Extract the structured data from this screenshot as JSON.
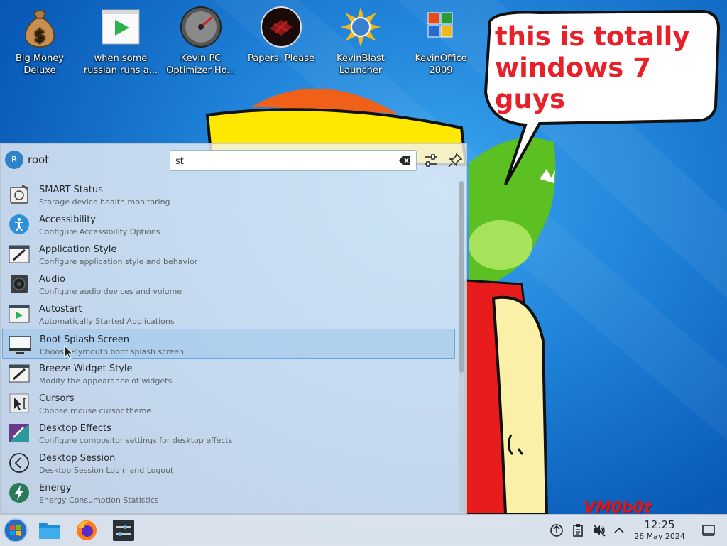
{
  "desktop": {
    "icons": [
      {
        "label": "Big Money\nDeluxe"
      },
      {
        "label": "when some\nrussian runs a..."
      },
      {
        "label": "Kevin PC\nOptimizer Ho..."
      },
      {
        "label": "Papers, Please"
      },
      {
        "label": "KevinBlast\nLauncher"
      },
      {
        "label": "KevinOffice\n2009"
      }
    ],
    "bubble_text": "this is totally windows 7 guys",
    "watermark": "VM0b0t"
  },
  "launcher": {
    "user": {
      "initial": "R",
      "name": "root"
    },
    "search": {
      "value": "st"
    },
    "results": [
      {
        "title": "SMART Status",
        "subtitle": "Storage device health monitoring",
        "icon": "disk-health-icon"
      },
      {
        "title": "Accessibility",
        "subtitle": "Configure Accessibility Options",
        "icon": "accessibility-icon"
      },
      {
        "title": "Application Style",
        "subtitle": "Configure application style and behavior",
        "icon": "brush-icon"
      },
      {
        "title": "Audio",
        "subtitle": "Configure audio devices and volume",
        "icon": "speaker-icon"
      },
      {
        "title": "Autostart",
        "subtitle": "Automatically Started Applications",
        "icon": "autostart-icon"
      },
      {
        "title": "Boot Splash Screen",
        "subtitle": "Choose Plymouth boot splash screen",
        "icon": "monitor-icon",
        "selected": true
      },
      {
        "title": "Breeze Widget Style",
        "subtitle": "Modify the appearance of widgets",
        "icon": "brush-icon"
      },
      {
        "title": "Cursors",
        "subtitle": "Choose mouse cursor theme",
        "icon": "cursor-theme-icon"
      },
      {
        "title": "Desktop Effects",
        "subtitle": "Configure compositor settings for desktop effects",
        "icon": "effects-icon"
      },
      {
        "title": "Desktop Session",
        "subtitle": "Desktop Session Login and Logout",
        "icon": "session-icon"
      },
      {
        "title": "Energy",
        "subtitle": "Energy Consumption Statistics",
        "icon": "energy-icon"
      }
    ]
  },
  "taskbar": {
    "clock": {
      "time": "12:25",
      "date": "26 May 2024"
    }
  },
  "colors": {
    "accent": "#3daee9",
    "bubble_text": "#e8202a",
    "selection": "#6aa6dc"
  }
}
